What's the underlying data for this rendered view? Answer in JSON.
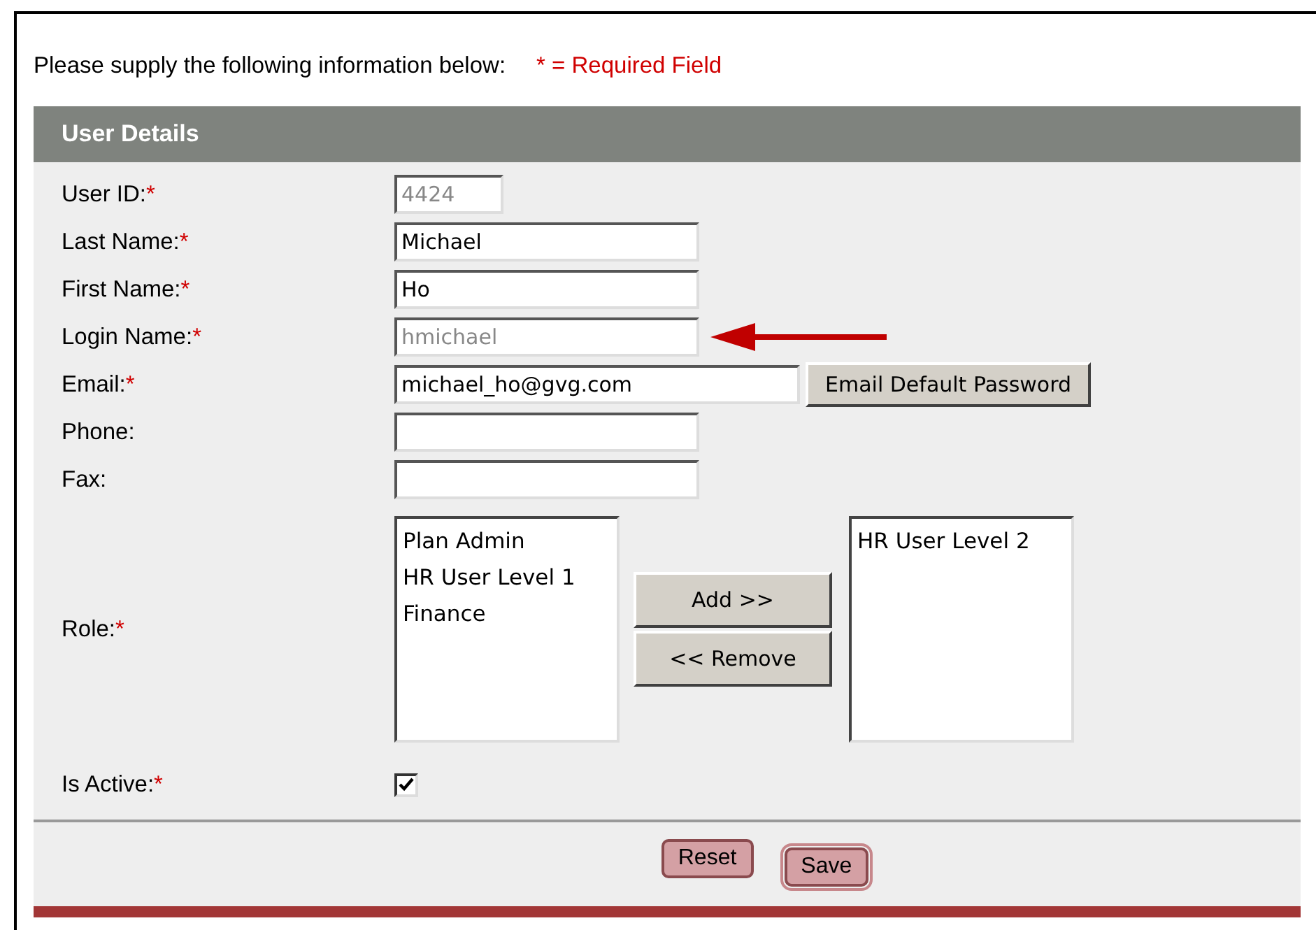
{
  "intro": {
    "text": "Please supply the following information below:",
    "required_note": "* = Required Field"
  },
  "panel": {
    "title": "User Details"
  },
  "fields": [
    {
      "kind": "short",
      "label": "User ID:",
      "required": "*",
      "value": "4424",
      "disabled": true
    },
    {
      "kind": "text",
      "label": "Last Name:",
      "required": "*",
      "value": "Michael",
      "disabled": false
    },
    {
      "kind": "text",
      "label": "First Name:",
      "required": "*",
      "value": "Ho",
      "disabled": false
    },
    {
      "kind": "text",
      "label": "Login Name:",
      "required": "*",
      "value": "hmichael",
      "disabled": true,
      "arrow": true
    },
    {
      "kind": "email",
      "label": "Email:",
      "required": "*",
      "value": "michael_ho@gvg.com",
      "disabled": false,
      "button": "Email Default Password"
    },
    {
      "kind": "text",
      "label": "Phone:"
    },
    {
      "kind": "text",
      "label": "Fax:"
    },
    {
      "kind": "roles",
      "label": "Role:",
      "required": "*",
      "available": [
        "Plan Admin",
        "HR User Level 1",
        "Finance"
      ],
      "add": "Add >>",
      "remove": "<< Remove",
      "assigned": [
        "HR User Level 2"
      ]
    },
    {
      "kind": "checkbox",
      "label": "Is Active:",
      "required": "*",
      "checked": true
    }
  ],
  "buttons": [
    "Reset",
    "Save"
  ]
}
